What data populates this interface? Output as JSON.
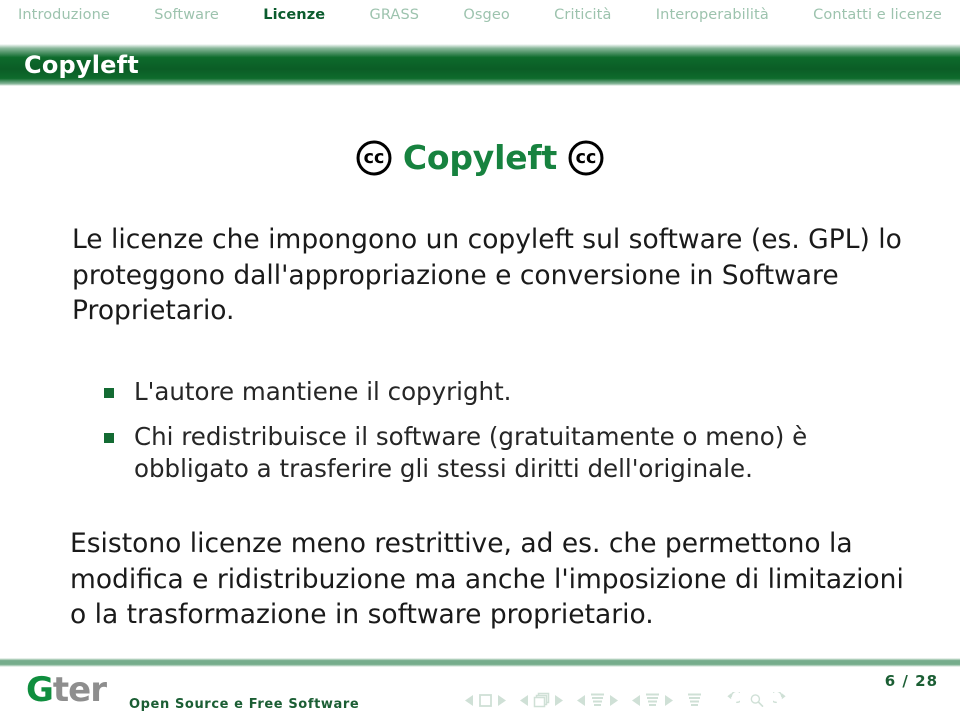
{
  "navbar": {
    "items": [
      {
        "label": "Introduzione",
        "active": false
      },
      {
        "label": "Software",
        "active": false
      },
      {
        "label": "Licenze",
        "active": true
      },
      {
        "label": "GRASS",
        "active": false
      },
      {
        "label": "Osgeo",
        "active": false
      },
      {
        "label": "Criticità",
        "active": false
      },
      {
        "label": "Interoperabilità",
        "active": false
      },
      {
        "label": "Contatti e licenze",
        "active": false
      }
    ],
    "inactive_color": "#9dc3ae",
    "active_color": "#0b5c2e"
  },
  "titlebar": {
    "title": "Copyleft",
    "background_color": "#0b5d26",
    "text_color": "#ffffff"
  },
  "slide": {
    "heading": {
      "text": "Copyleft",
      "color": "#17823f",
      "left_icon": "creative-commons-icon",
      "right_icon": "creative-commons-icon",
      "icon_glyph": "cc"
    },
    "paragraph_1": "Le licenze che impongono un copyleft sul software (es. GPL) lo proteggono dall'appropriazione e conversione in Software Proprietario.",
    "bullets": [
      "L'autore mantiene il copyright.",
      "Chi redistribuisce il software (gratuitamente o meno) è obbligato a trasferire gli stessi diritti dell'originale."
    ],
    "bullet_color": "#136b33",
    "paragraph_2": "Esistono licenze meno restrittive, ad es. che permettono la modifica e ridistribuzione ma anche l'imposizione di limitazioni o la trasformazione in software proprietario."
  },
  "footer": {
    "logo": {
      "part_green": "G",
      "part_gray": "ter"
    },
    "tagline": "Open Source e Free Software",
    "band_color": "#76ad8c",
    "navigation": {
      "color": "#cfe0d6",
      "groups": [
        {
          "name": "slide-navigation",
          "symbol": "square-icon"
        },
        {
          "name": "frame-navigation",
          "symbol": "stacked-frames-icon"
        },
        {
          "name": "subsection-navigation",
          "symbol": "lines-icon"
        },
        {
          "name": "section-navigation",
          "symbol": "lines-icon"
        }
      ],
      "presentation_icon": "lines-icon",
      "back_icon": "undo-arrow-icon",
      "search_icon": "magnifier-icon",
      "forward_icon": "redo-arrow-icon"
    },
    "page_number": "6 / 28"
  }
}
